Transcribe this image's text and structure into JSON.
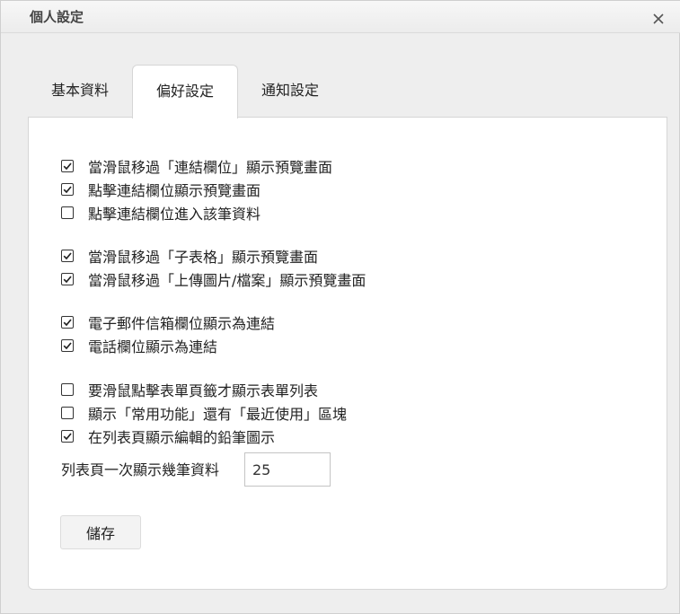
{
  "dialog": {
    "title": "個人設定"
  },
  "tabs": [
    {
      "label": "基本資料",
      "active": false
    },
    {
      "label": "偏好設定",
      "active": true
    },
    {
      "label": "通知設定",
      "active": false
    }
  ],
  "options": [
    {
      "label": "當滑鼠移過「連結欄位」顯示預覽畫面",
      "checked": true
    },
    {
      "label": "點擊連結欄位顯示預覽畫面",
      "checked": true
    },
    {
      "label": "點擊連結欄位進入該筆資料",
      "checked": false
    },
    {
      "label": "當滑鼠移過「子表格」顯示預覽畫面",
      "checked": true
    },
    {
      "label": "當滑鼠移過「上傳圖片/檔案」顯示預覽畫面",
      "checked": true
    },
    {
      "label": "電子郵件信箱欄位顯示為連結",
      "checked": true
    },
    {
      "label": "電話欄位顯示為連結",
      "checked": true
    },
    {
      "label": "要滑鼠點擊表單頁籤才顯示表單列表",
      "checked": false
    },
    {
      "label": "顯示「常用功能」還有「最近使用」區塊",
      "checked": false
    },
    {
      "label": "在列表頁顯示編輯的鉛筆圖示",
      "checked": true
    }
  ],
  "rows_per_page": {
    "label": "列表頁一次顯示幾筆資料",
    "value": "25"
  },
  "save_label": "儲存"
}
